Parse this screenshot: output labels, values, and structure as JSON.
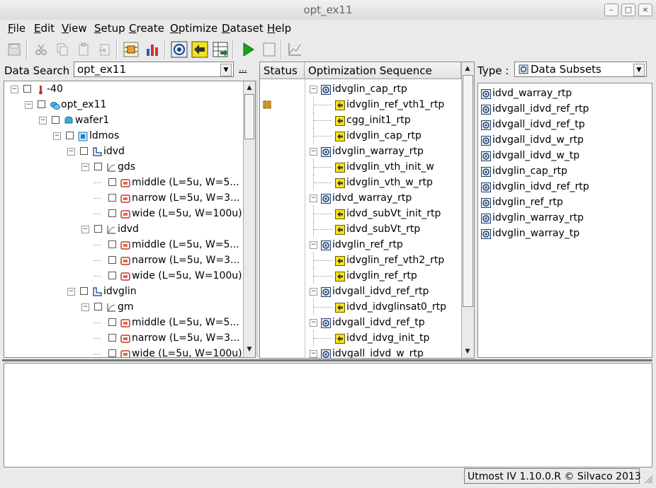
{
  "window": {
    "title": "opt_ex11",
    "btn_min": "–",
    "btn_max": "□",
    "btn_close": "×"
  },
  "menu": [
    {
      "label": "File",
      "key": "F"
    },
    {
      "label": "Edit",
      "key": "E"
    },
    {
      "label": "View",
      "key": "V"
    },
    {
      "label": "Setup",
      "key": "S"
    },
    {
      "label": "Create",
      "key": "C"
    },
    {
      "label": "Optimize",
      "key": "O"
    },
    {
      "label": "Dataset",
      "key": "D"
    },
    {
      "label": "Help",
      "key": "H"
    }
  ],
  "toolbar": [
    "save-icon",
    "cut-icon",
    "copy-icon",
    "paste-icon",
    "paste-special-icon",
    "circuit-icon",
    "bar-chart-icon",
    "target-icon",
    "yellow-arrow-icon",
    "table-import-icon",
    "play-icon",
    "stop-icon",
    "plot-icon"
  ],
  "left": {
    "search_label": "Data Search :",
    "search_value": "opt_ex11",
    "browse_btn": "...",
    "tree": [
      {
        "label": "-40",
        "level": 0,
        "icon": "temperature-icon"
      },
      {
        "label": "opt_ex11",
        "level": 1,
        "icon": "project-icon"
      },
      {
        "label": "wafer1",
        "level": 2,
        "icon": "wafer-icon"
      },
      {
        "label": "ldmos",
        "level": 3,
        "icon": "device-icon"
      },
      {
        "label": "idvd",
        "level": 4,
        "icon": "routine-icon"
      },
      {
        "label": "gds",
        "level": 5,
        "icon": "plot-icon"
      },
      {
        "label": "middle (L=5u, W=5...",
        "level": 6,
        "icon": "curve-data-icon"
      },
      {
        "label": "narrow (L=5u, W=3...",
        "level": 6,
        "icon": "curve-data-icon"
      },
      {
        "label": "wide (L=5u, W=100u)",
        "level": 6,
        "icon": "curve-data-icon"
      },
      {
        "label": "idvd",
        "level": 5,
        "icon": "plot-icon"
      },
      {
        "label": "middle (L=5u, W=5...",
        "level": 6,
        "icon": "curve-data-icon"
      },
      {
        "label": "narrow (L=5u, W=3...",
        "level": 6,
        "icon": "curve-data-icon"
      },
      {
        "label": "wide (L=5u, W=100u)",
        "level": 6,
        "icon": "curve-data-icon"
      },
      {
        "label": "idvglin",
        "level": 4,
        "icon": "routine-icon"
      },
      {
        "label": "gm",
        "level": 5,
        "icon": "plot-icon"
      },
      {
        "label": "middle (L=5u, W=5...",
        "level": 6,
        "icon": "curve-data-icon"
      },
      {
        "label": "narrow (L=5u, W=3...",
        "level": 6,
        "icon": "curve-data-icon"
      },
      {
        "label": "wide (L=5u, W=100u)",
        "level": 6,
        "icon": "curve-data-icon"
      }
    ]
  },
  "middle": {
    "col_status": "Status",
    "col_sequence": "Optimization Sequence",
    "status_row_index": 1,
    "rows": [
      {
        "label": "idvglin_cap_rtp",
        "level": 0
      },
      {
        "label": "idvglin_ref_vth1_rtp",
        "level": 1
      },
      {
        "label": "cgg_init1_rtp",
        "level": 1
      },
      {
        "label": "idvglin_cap_rtp",
        "level": 1
      },
      {
        "label": "idvglin_warray_rtp",
        "level": 0
      },
      {
        "label": "idvglin_vth_init_w",
        "level": 1
      },
      {
        "label": "idvglin_vth_w_rtp",
        "level": 1
      },
      {
        "label": "idvd_warray_rtp",
        "level": 0
      },
      {
        "label": "idvd_subVt_init_rtp",
        "level": 1
      },
      {
        "label": "idvd_subVt_rtp",
        "level": 1
      },
      {
        "label": "idvglin_ref_rtp",
        "level": 0
      },
      {
        "label": "idvglin_ref_vth2_rtp",
        "level": 1
      },
      {
        "label": "idvglin_ref_rtp",
        "level": 1
      },
      {
        "label": "idvgall_idvd_ref_rtp",
        "level": 0
      },
      {
        "label": "idvd_idvglinsat0_rtp",
        "level": 1
      },
      {
        "label": "idvgall_idvd_ref_tp",
        "level": 0
      },
      {
        "label": "idvd_idvg_init_tp",
        "level": 1
      },
      {
        "label": "idvgall_idvd_w_rtp",
        "level": 0
      }
    ]
  },
  "right": {
    "type_label": "Type :",
    "type_value": "Data Subsets",
    "items": [
      "idvd_warray_rtp",
      "idvgall_idvd_ref_rtp",
      "idvgall_idvd_ref_tp",
      "idvgall_idvd_w_rtp",
      "idvgall_idvd_w_tp",
      "idvglin_cap_rtp",
      "idvglin_idvd_ref_rtp",
      "idvglin_ref_rtp",
      "idvglin_warray_rtp",
      "idvglin_warray_tp"
    ]
  },
  "statusbar": {
    "text": "Utmost IV 1.10.0.R © Silvaco 2013"
  }
}
